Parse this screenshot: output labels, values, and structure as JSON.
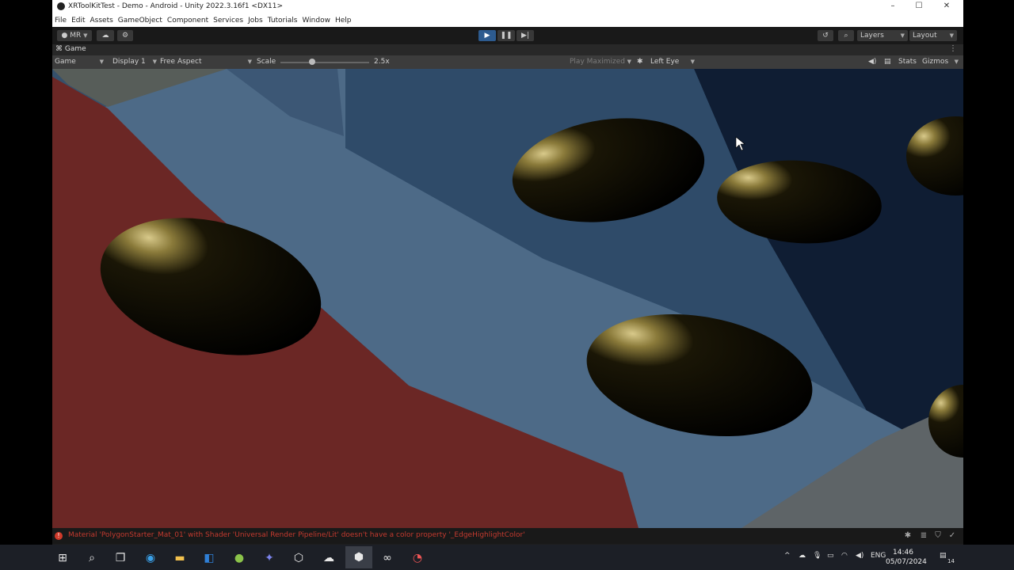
{
  "window": {
    "title": "XRToolKitTest - Demo - Android - Unity 2022.3.16f1 <DX11>",
    "controls": {
      "minimize": "–",
      "maximize": "☐",
      "close": "✕"
    }
  },
  "menu": [
    "File",
    "Edit",
    "Assets",
    "GameObject",
    "Component",
    "Services",
    "Jobs",
    "Tutorials",
    "Window",
    "Help"
  ],
  "toolbar": {
    "account_label": "MR",
    "layers_label": "Layers",
    "layout_label": "Layout",
    "play_icon": "play-icon",
    "pause_icon": "pause-icon",
    "step_icon": "step-icon"
  },
  "tab": {
    "label": "Game"
  },
  "gamebar": {
    "mode": "Game",
    "display": "Display 1",
    "aspect": "Free Aspect",
    "scale_label": "Scale",
    "scale_value": "2.5x",
    "scale_level": 0.36,
    "play_maximized": "Play Maximized",
    "eye": "Left Eye",
    "stats": "Stats",
    "gizmos": "Gizmos"
  },
  "status": {
    "error": "Material 'PolygonStarter_Mat_01' with Shader 'Universal Render Pipeline/Lit' doesn't have a color property '_EdgeHighlightColor'"
  },
  "clock": {
    "time": "14:46",
    "date": "05/07/2024"
  },
  "tray": {
    "language": "ENG",
    "notifications": "14"
  },
  "colors": {
    "accent": "#2d5b8f",
    "error": "#c43a2f"
  }
}
